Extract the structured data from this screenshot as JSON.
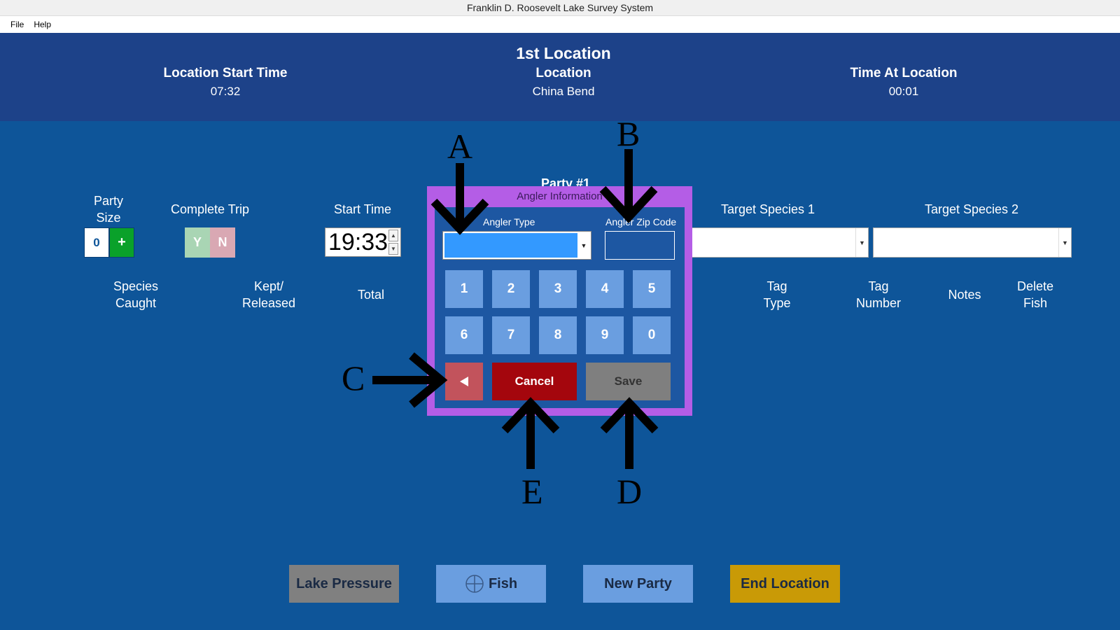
{
  "window": {
    "title": "Franklin D. Roosevelt Lake Survey System"
  },
  "menu": {
    "file": "File",
    "help": "Help"
  },
  "header": {
    "location_title": "1st Location",
    "start_time_label": "Location Start Time",
    "start_time_value": "07:32",
    "location_label": "Location",
    "location_value": "China Bend",
    "time_at_label": "Time At Location",
    "time_at_value": "00:01"
  },
  "party": {
    "title": "Party #1",
    "size_label_1": "Party",
    "size_label_2": "Size",
    "size_value": "0",
    "size_plus": "+",
    "complete_trip_label": "Complete Trip",
    "yes": "Y",
    "no": "N",
    "start_time_label": "Start Time",
    "start_time_value": "19:33",
    "target1_label": "Target Species 1",
    "target2_label": "Target Species 2"
  },
  "columns": {
    "species_1": "Species",
    "species_2": "Caught",
    "kept_1": "Kept/",
    "kept_2": "Released",
    "total": "Total",
    "tag_type_1": "Tag",
    "tag_type_2": "Type",
    "tag_num_1": "Tag",
    "tag_num_2": "Number",
    "notes": "Notes",
    "delete_1": "Delete",
    "delete_2": "Fish"
  },
  "dialog": {
    "title": "Angler Information",
    "angler_type_label": "Angler Type",
    "angler_zip_label": "Angler Zip Code",
    "keys": [
      "1",
      "2",
      "3",
      "4",
      "5",
      "6",
      "7",
      "8",
      "9",
      "0"
    ],
    "cancel": "Cancel",
    "save": "Save"
  },
  "bottom": {
    "lake_pressure": "Lake Pressure",
    "fish": "Fish",
    "new_party": "New Party",
    "end_location": "End Location"
  },
  "annotations": {
    "a": "A",
    "b": "B",
    "c": "C",
    "d": "D",
    "e": "E"
  },
  "colors": {
    "header_bg": "#1d4289",
    "main_bg": "#0e5599",
    "dialog_border": "#b45de6",
    "dialog_bg": "#1d57a2",
    "key_bg": "#6a9ee0",
    "cancel_bg": "#a4060d",
    "save_bg": "#7f7f7f",
    "backspace_bg": "#c2535c",
    "plus_bg": "#0aa12a",
    "end_location_bg": "#c99a06",
    "blue_button_bg": "#6a9ee0",
    "gray_button_bg": "#808080"
  }
}
